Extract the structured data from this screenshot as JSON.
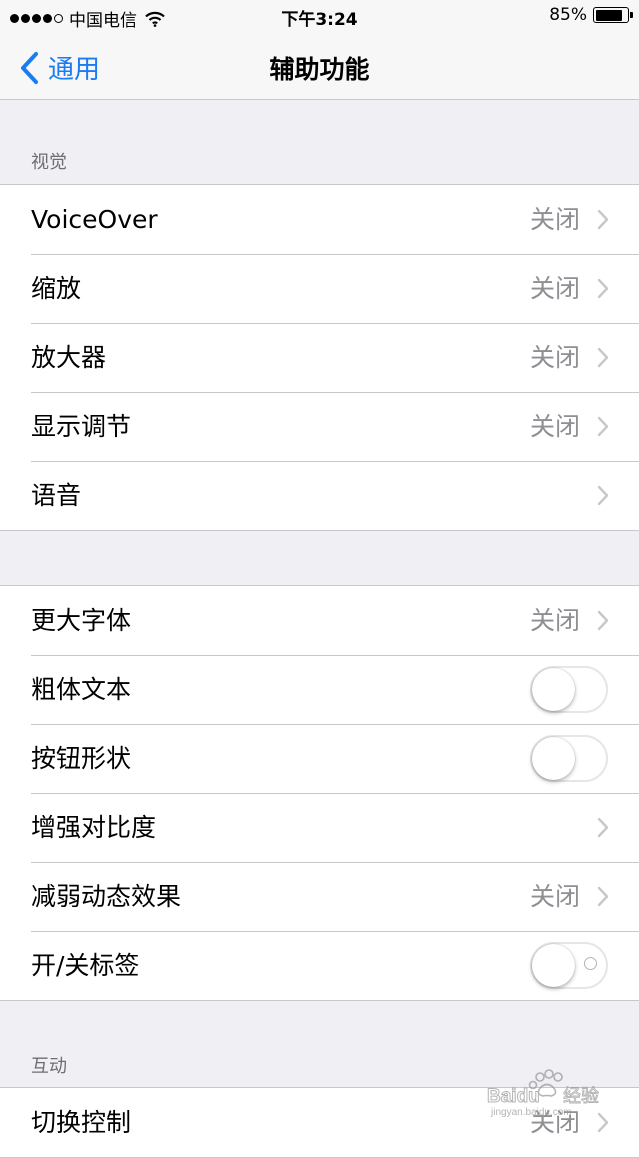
{
  "status_bar": {
    "signal_dots": [
      true,
      true,
      true,
      true,
      false
    ],
    "carrier": "中国电信",
    "wifi_icon": "wifi-icon",
    "time": "下午3:24",
    "battery_text": "85%",
    "battery_level": 0.85
  },
  "nav": {
    "back_label": "通用",
    "title": "辅助功能"
  },
  "sections": {
    "vision_header": "视觉",
    "interaction_header": "互动"
  },
  "vision_rows": [
    {
      "label": "VoiceOver",
      "value": "关闭"
    },
    {
      "label": "缩放",
      "value": "关闭"
    },
    {
      "label": "放大器",
      "value": "关闭"
    },
    {
      "label": "显示调节",
      "value": "关闭"
    },
    {
      "label": "语音",
      "value": ""
    }
  ],
  "text_rows": [
    {
      "label": "更大字体",
      "value": "关闭",
      "type": "link"
    },
    {
      "label": "粗体文本",
      "type": "switch",
      "on": false
    },
    {
      "label": "按钮形状",
      "type": "switch",
      "on": false
    },
    {
      "label": "增强对比度",
      "value": "",
      "type": "link"
    },
    {
      "label": "减弱动态效果",
      "value": "关闭",
      "type": "link"
    },
    {
      "label": "开/关标签",
      "type": "switch",
      "on": false
    }
  ],
  "interaction_rows": [
    {
      "label": "切换控制",
      "value": "关闭"
    }
  ],
  "watermark": {
    "brand": "Baidu",
    "brand_cn": "经验",
    "url": "jingyan.baidu.com"
  },
  "colors": {
    "accent": "#1a7cf5",
    "background": "#efeff4",
    "separator": "#c8c7cc",
    "secondary_text": "#8e8e93"
  }
}
